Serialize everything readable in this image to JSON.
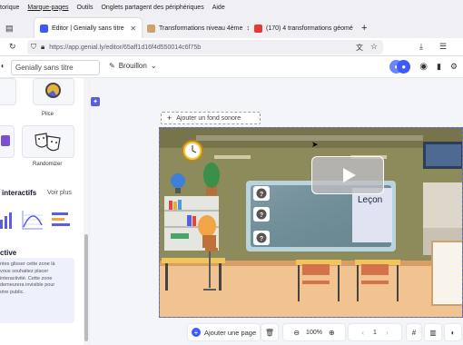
{
  "browser": {
    "menu": [
      "torique",
      "Marque-pages",
      "Outils",
      "Onglets partagent des périphériques",
      "Aide"
    ],
    "tabs": [
      {
        "title": "Editor | Genially sans titre",
        "active": true,
        "favicon_color": "#3d5afe"
      },
      {
        "title": "Transformations niveau 4ème",
        "active": false,
        "favicon_color": "#caa46a"
      },
      {
        "title": "(170) 4 transformations géomé",
        "active": false,
        "favicon_color": "#e53935"
      }
    ],
    "new_tab": "+",
    "url": "https://app.genial.ly/editor/65aff1d16f4d550014c6f75b"
  },
  "app": {
    "title_value": "Genially sans titre",
    "draft_label": "Brouillon"
  },
  "sidebar": {
    "tiles": [
      {
        "label": "Pilce"
      },
      {
        "label": "Randomizer"
      }
    ],
    "section_title": "interactifs",
    "see_more": "Voir plus",
    "active_title": "ctive",
    "info_text": [
      "ntes glisser cette zone là",
      "vous souhaitez placer",
      "interactivité. Cette zone",
      "demeurera invisible pour",
      "otre public."
    ]
  },
  "editor": {
    "add_sound": "Ajouter un fond sonore",
    "slide_label": "Leçon",
    "add_page": "Ajouter une page",
    "zoom": "100%",
    "page_number": "1"
  },
  "colors": {
    "brand": "#3d5afe",
    "slide_wall": "#8d8a5c",
    "board": "#6f8f9a"
  }
}
